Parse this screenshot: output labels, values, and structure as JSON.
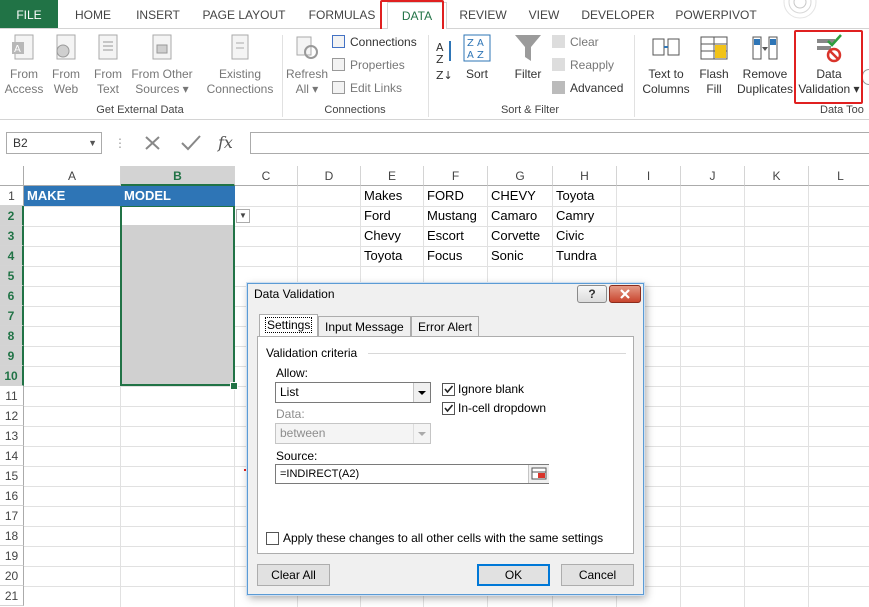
{
  "ribbon_tabs": [
    "FILE",
    "HOME",
    "INSERT",
    "PAGE LAYOUT",
    "FORMULAS",
    "DATA",
    "REVIEW",
    "VIEW",
    "DEVELOPER",
    "POWERPIVOT"
  ],
  "active_tab": "DATA",
  "ribbon": {
    "get_external_data": {
      "label": "Get External Data",
      "from_access": [
        "From",
        "Access"
      ],
      "from_web": [
        "From",
        "Web"
      ],
      "from_text": [
        "From",
        "Text"
      ],
      "from_other": [
        "From Other",
        "Sources ▾"
      ],
      "existing": [
        "Existing",
        "Connections"
      ]
    },
    "connections": {
      "label": "Connections",
      "refresh": [
        "Refresh",
        "All ▾"
      ],
      "connections": "Connections",
      "properties": "Properties",
      "edit_links": "Edit Links"
    },
    "sort_filter": {
      "label": "Sort & Filter",
      "sort": "Sort",
      "filter": "Filter",
      "clear": "Clear",
      "reapply": "Reapply",
      "advanced": "Advanced"
    },
    "data_tools": {
      "label": "Data Too",
      "text_to_columns": [
        "Text to",
        "Columns"
      ],
      "flash_fill": [
        "Flash",
        "Fill"
      ],
      "remove_duplicates": [
        "Remove",
        "Duplicates"
      ],
      "data_validation": [
        "Data",
        "Validation ▾"
      ]
    }
  },
  "formula_bar": {
    "name_box": "B2",
    "fx": "fx",
    "formula": ""
  },
  "sheet": {
    "columns": [
      "A",
      "B",
      "C",
      "D",
      "E",
      "F",
      "G",
      "H",
      "I",
      "J",
      "K",
      "L"
    ],
    "rows": [
      "1",
      "2",
      "3",
      "4",
      "5",
      "6",
      "7",
      "8",
      "9",
      "10",
      "11",
      "12",
      "13",
      "14",
      "15",
      "16",
      "17",
      "18",
      "19",
      "20",
      "21"
    ],
    "a1": "MAKE",
    "b1": "MODEL",
    "table": [
      [
        "Makes",
        "FORD",
        "CHEVY",
        "Toyota"
      ],
      [
        "Ford",
        "Mustang",
        "Camaro",
        "Camry"
      ],
      [
        "Chevy",
        "Escort",
        "Corvette",
        "Civic"
      ],
      [
        "Toyota",
        "Focus",
        "Sonic",
        "Tundra"
      ]
    ]
  },
  "dialog": {
    "title": "Data Validation",
    "help": "?",
    "tabs": [
      "Settings",
      "Input Message",
      "Error Alert"
    ],
    "section": "Validation criteria",
    "allow_label": "Allow:",
    "allow_value": "List",
    "ignore_blank": "Ignore blank",
    "in_cell_dropdown": "In-cell dropdown",
    "data_label": "Data:",
    "data_value": "between",
    "source_label": "Source:",
    "source_value": "=INDIRECT(A2)",
    "apply_all": "Apply these changes to all other cells with the same settings",
    "clear_all": "Clear All",
    "ok": "OK",
    "cancel": "Cancel"
  }
}
